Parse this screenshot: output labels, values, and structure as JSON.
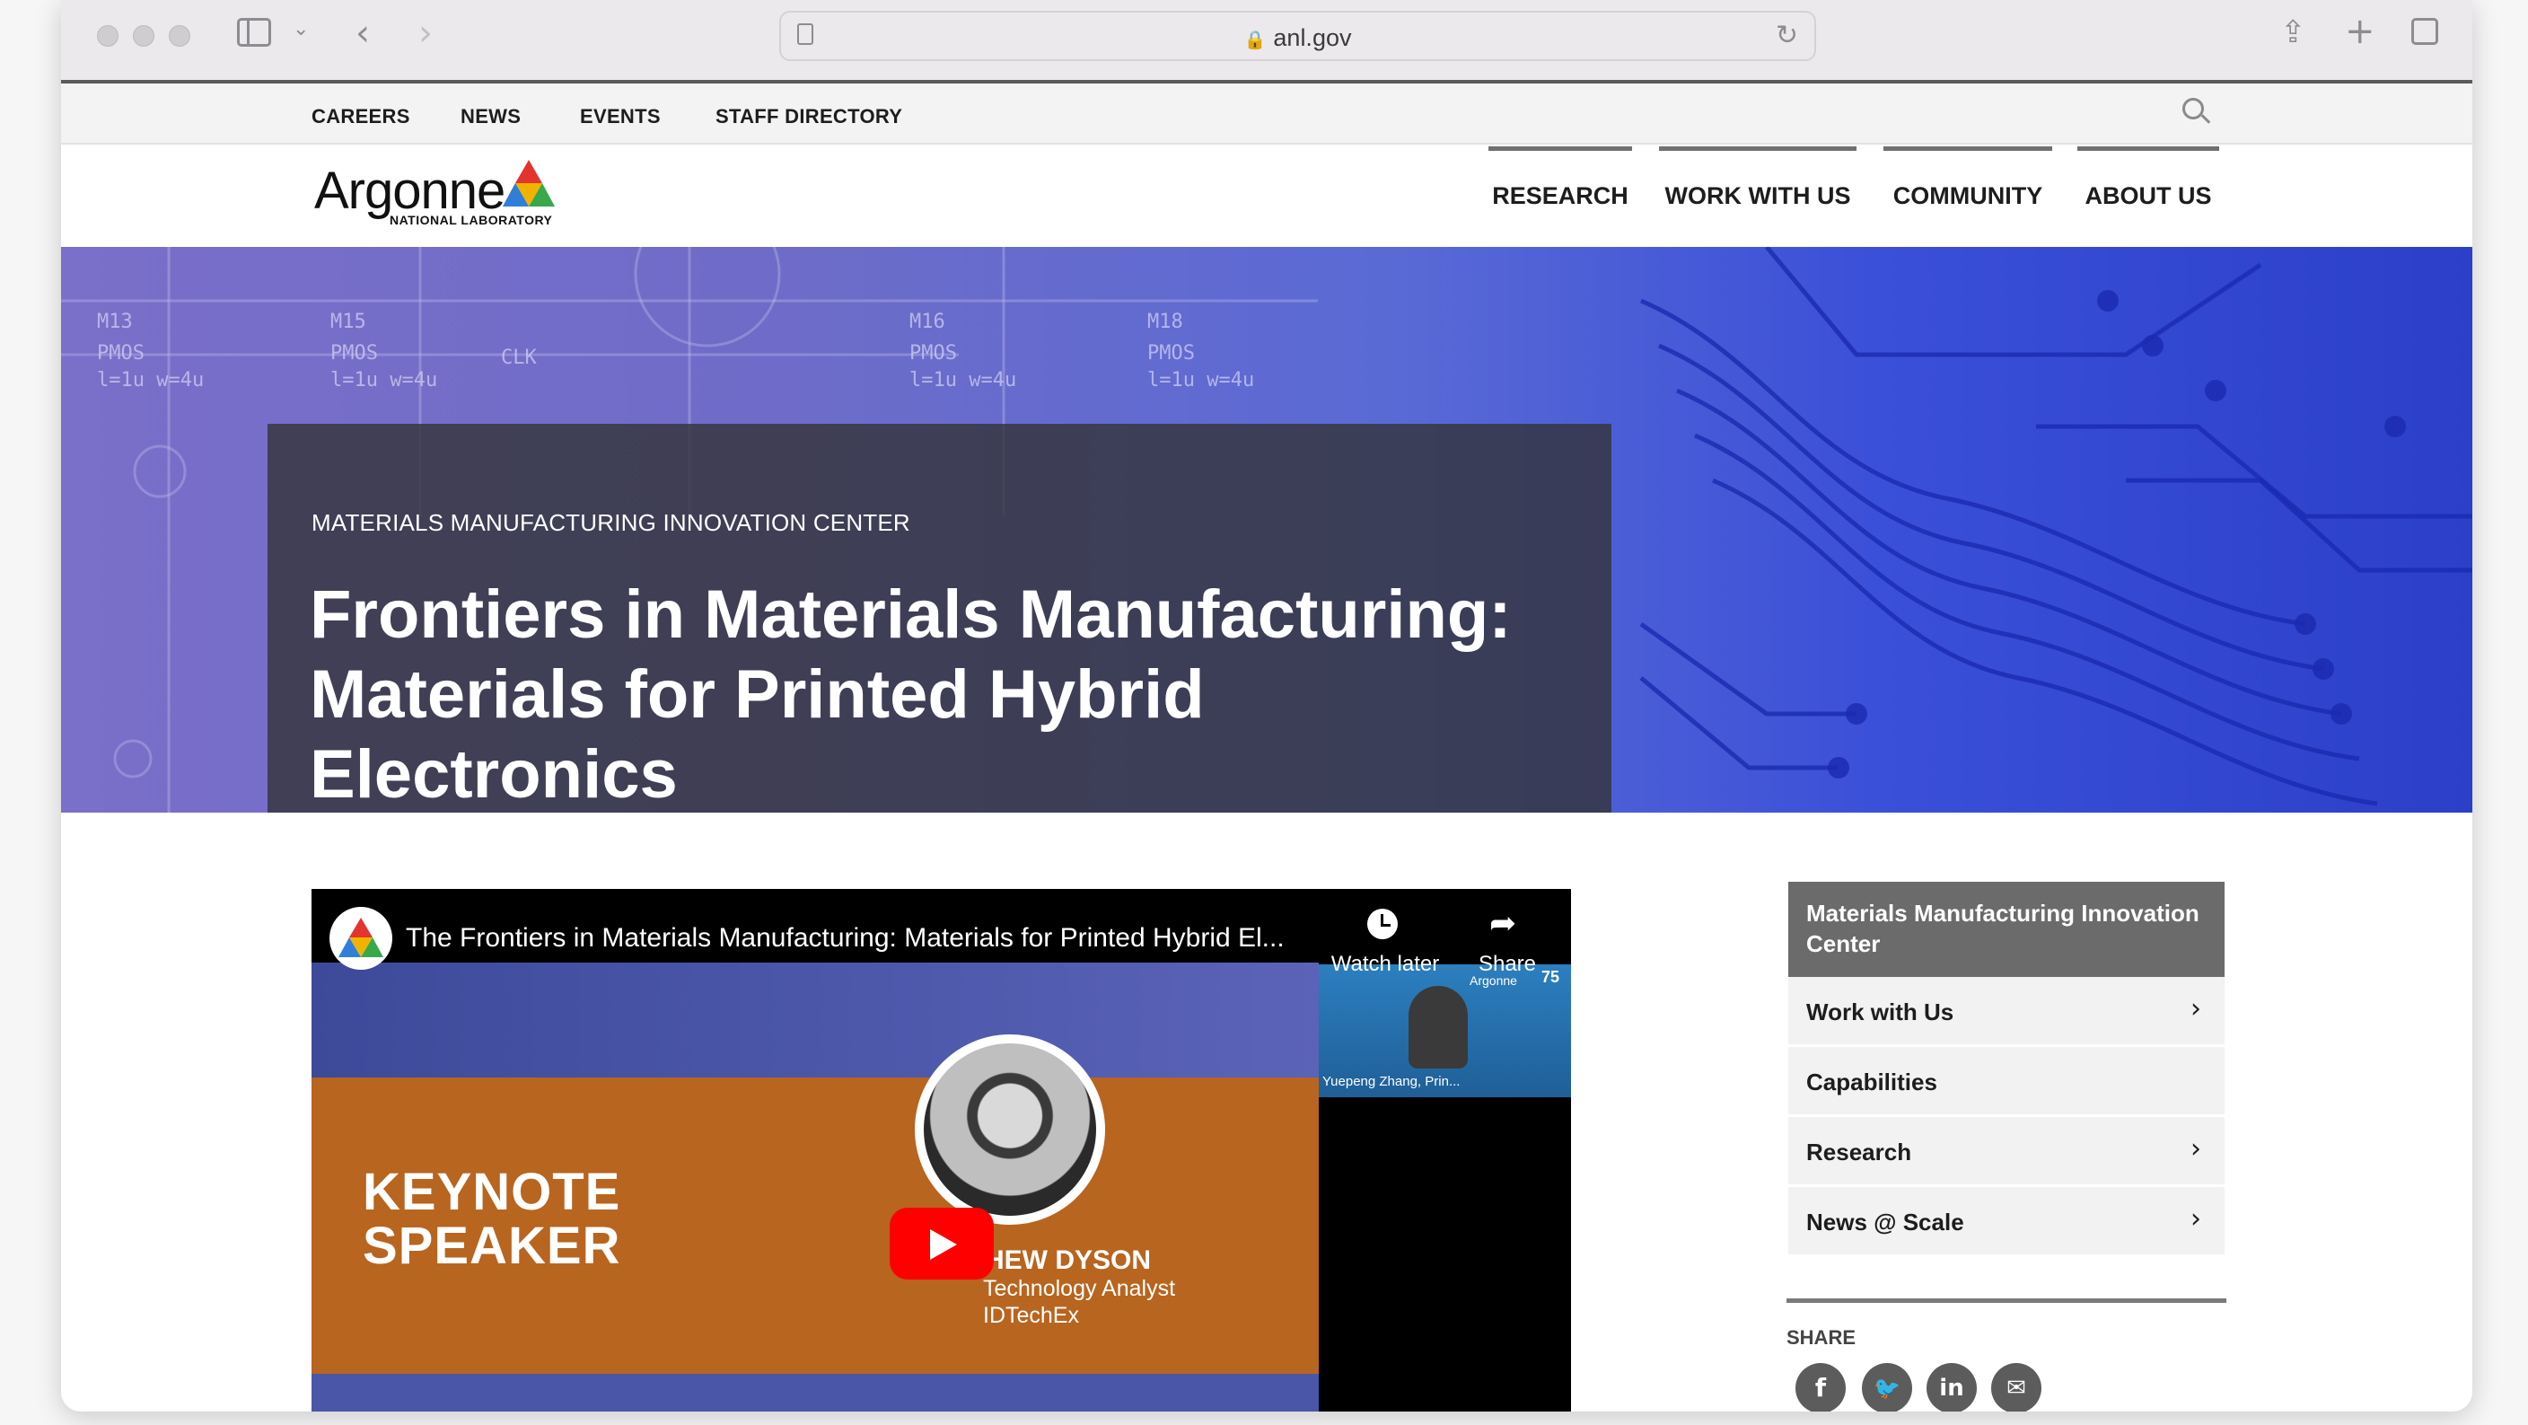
{
  "browser": {
    "url": "anl.gov"
  },
  "utility_nav": [
    "CAREERS",
    "NEWS",
    "EVENTS",
    "STAFF DIRECTORY"
  ],
  "logo": {
    "name": "Argonne",
    "subtitle": "NATIONAL LABORATORY"
  },
  "main_nav": [
    "RESEARCH",
    "WORK WITH US",
    "COMMUNITY",
    "ABOUT US"
  ],
  "hero": {
    "eyebrow": "MATERIALS MANUFACTURING INNOVATION CENTER",
    "title": "Frontiers in Materials Manufacturing: Materials for Printed Hybrid Electronics",
    "bg_labels": [
      "M13",
      "PMOS",
      "l=1u w=4u",
      "M15",
      "PMOS",
      "l=1u w=4u",
      "CLK",
      "M16",
      "PMOS",
      "l=1u w=4u",
      "M18",
      "PMOS",
      "l=1u w=4u"
    ]
  },
  "video": {
    "title": "The Frontiers in Materials Manufacturing: Materials for Printed Hybrid El...",
    "watch_later": "Watch later",
    "share": "Share",
    "thumb_brand": "Argonne",
    "thumb_number": "75",
    "thumb_caption": "Yuepeng Zhang, Prin...",
    "slide_heading": "KEYNOTE SPEAKER",
    "speaker_name": "HEW DYSON",
    "speaker_role": "Technology Analyst",
    "speaker_org": "IDTechEx"
  },
  "sidebar": {
    "heading": "Materials Manufacturing Innovation Center",
    "items": [
      {
        "label": "Work with Us",
        "chevron": true
      },
      {
        "label": "Capabilities",
        "chevron": false
      },
      {
        "label": "Research",
        "chevron": true
      },
      {
        "label": "News @ Scale",
        "chevron": true
      }
    ]
  },
  "share": {
    "label": "SHARE",
    "icons": [
      "facebook-icon",
      "twitter-icon",
      "linkedin-icon",
      "email-icon"
    ]
  },
  "colors": {
    "hero_overlay": "#34343c",
    "sidebar_head": "#6b6b6b",
    "youtube_red": "#ff0000"
  }
}
